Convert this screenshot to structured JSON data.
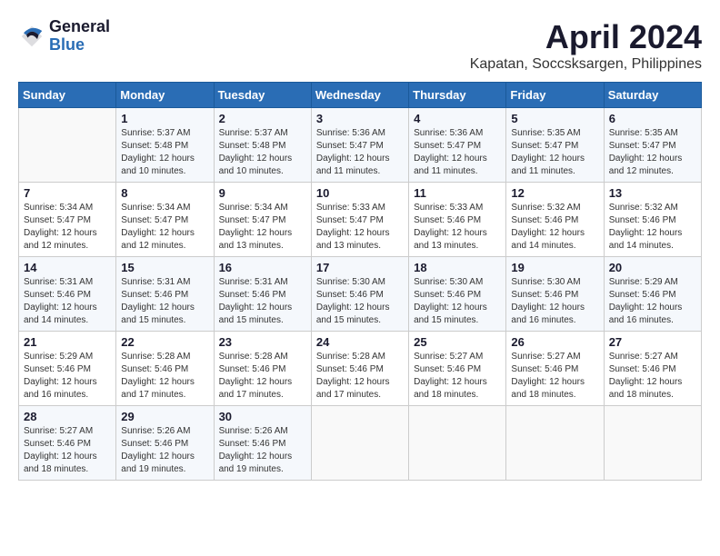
{
  "header": {
    "logo_general": "General",
    "logo_blue": "Blue",
    "month_title": "April 2024",
    "location": "Kapatan, Soccsksargen, Philippines"
  },
  "weekdays": [
    "Sunday",
    "Monday",
    "Tuesday",
    "Wednesday",
    "Thursday",
    "Friday",
    "Saturday"
  ],
  "weeks": [
    [
      {
        "day": "",
        "info": ""
      },
      {
        "day": "1",
        "info": "Sunrise: 5:37 AM\nSunset: 5:48 PM\nDaylight: 12 hours\nand 10 minutes."
      },
      {
        "day": "2",
        "info": "Sunrise: 5:37 AM\nSunset: 5:48 PM\nDaylight: 12 hours\nand 10 minutes."
      },
      {
        "day": "3",
        "info": "Sunrise: 5:36 AM\nSunset: 5:47 PM\nDaylight: 12 hours\nand 11 minutes."
      },
      {
        "day": "4",
        "info": "Sunrise: 5:36 AM\nSunset: 5:47 PM\nDaylight: 12 hours\nand 11 minutes."
      },
      {
        "day": "5",
        "info": "Sunrise: 5:35 AM\nSunset: 5:47 PM\nDaylight: 12 hours\nand 11 minutes."
      },
      {
        "day": "6",
        "info": "Sunrise: 5:35 AM\nSunset: 5:47 PM\nDaylight: 12 hours\nand 12 minutes."
      }
    ],
    [
      {
        "day": "7",
        "info": "Sunrise: 5:34 AM\nSunset: 5:47 PM\nDaylight: 12 hours\nand 12 minutes."
      },
      {
        "day": "8",
        "info": "Sunrise: 5:34 AM\nSunset: 5:47 PM\nDaylight: 12 hours\nand 12 minutes."
      },
      {
        "day": "9",
        "info": "Sunrise: 5:34 AM\nSunset: 5:47 PM\nDaylight: 12 hours\nand 13 minutes."
      },
      {
        "day": "10",
        "info": "Sunrise: 5:33 AM\nSunset: 5:47 PM\nDaylight: 12 hours\nand 13 minutes."
      },
      {
        "day": "11",
        "info": "Sunrise: 5:33 AM\nSunset: 5:46 PM\nDaylight: 12 hours\nand 13 minutes."
      },
      {
        "day": "12",
        "info": "Sunrise: 5:32 AM\nSunset: 5:46 PM\nDaylight: 12 hours\nand 14 minutes."
      },
      {
        "day": "13",
        "info": "Sunrise: 5:32 AM\nSunset: 5:46 PM\nDaylight: 12 hours\nand 14 minutes."
      }
    ],
    [
      {
        "day": "14",
        "info": "Sunrise: 5:31 AM\nSunset: 5:46 PM\nDaylight: 12 hours\nand 14 minutes."
      },
      {
        "day": "15",
        "info": "Sunrise: 5:31 AM\nSunset: 5:46 PM\nDaylight: 12 hours\nand 15 minutes."
      },
      {
        "day": "16",
        "info": "Sunrise: 5:31 AM\nSunset: 5:46 PM\nDaylight: 12 hours\nand 15 minutes."
      },
      {
        "day": "17",
        "info": "Sunrise: 5:30 AM\nSunset: 5:46 PM\nDaylight: 12 hours\nand 15 minutes."
      },
      {
        "day": "18",
        "info": "Sunrise: 5:30 AM\nSunset: 5:46 PM\nDaylight: 12 hours\nand 15 minutes."
      },
      {
        "day": "19",
        "info": "Sunrise: 5:30 AM\nSunset: 5:46 PM\nDaylight: 12 hours\nand 16 minutes."
      },
      {
        "day": "20",
        "info": "Sunrise: 5:29 AM\nSunset: 5:46 PM\nDaylight: 12 hours\nand 16 minutes."
      }
    ],
    [
      {
        "day": "21",
        "info": "Sunrise: 5:29 AM\nSunset: 5:46 PM\nDaylight: 12 hours\nand 16 minutes."
      },
      {
        "day": "22",
        "info": "Sunrise: 5:28 AM\nSunset: 5:46 PM\nDaylight: 12 hours\nand 17 minutes."
      },
      {
        "day": "23",
        "info": "Sunrise: 5:28 AM\nSunset: 5:46 PM\nDaylight: 12 hours\nand 17 minutes."
      },
      {
        "day": "24",
        "info": "Sunrise: 5:28 AM\nSunset: 5:46 PM\nDaylight: 12 hours\nand 17 minutes."
      },
      {
        "day": "25",
        "info": "Sunrise: 5:27 AM\nSunset: 5:46 PM\nDaylight: 12 hours\nand 18 minutes."
      },
      {
        "day": "26",
        "info": "Sunrise: 5:27 AM\nSunset: 5:46 PM\nDaylight: 12 hours\nand 18 minutes."
      },
      {
        "day": "27",
        "info": "Sunrise: 5:27 AM\nSunset: 5:46 PM\nDaylight: 12 hours\nand 18 minutes."
      }
    ],
    [
      {
        "day": "28",
        "info": "Sunrise: 5:27 AM\nSunset: 5:46 PM\nDaylight: 12 hours\nand 18 minutes."
      },
      {
        "day": "29",
        "info": "Sunrise: 5:26 AM\nSunset: 5:46 PM\nDaylight: 12 hours\nand 19 minutes."
      },
      {
        "day": "30",
        "info": "Sunrise: 5:26 AM\nSunset: 5:46 PM\nDaylight: 12 hours\nand 19 minutes."
      },
      {
        "day": "",
        "info": ""
      },
      {
        "day": "",
        "info": ""
      },
      {
        "day": "",
        "info": ""
      },
      {
        "day": "",
        "info": ""
      }
    ]
  ]
}
